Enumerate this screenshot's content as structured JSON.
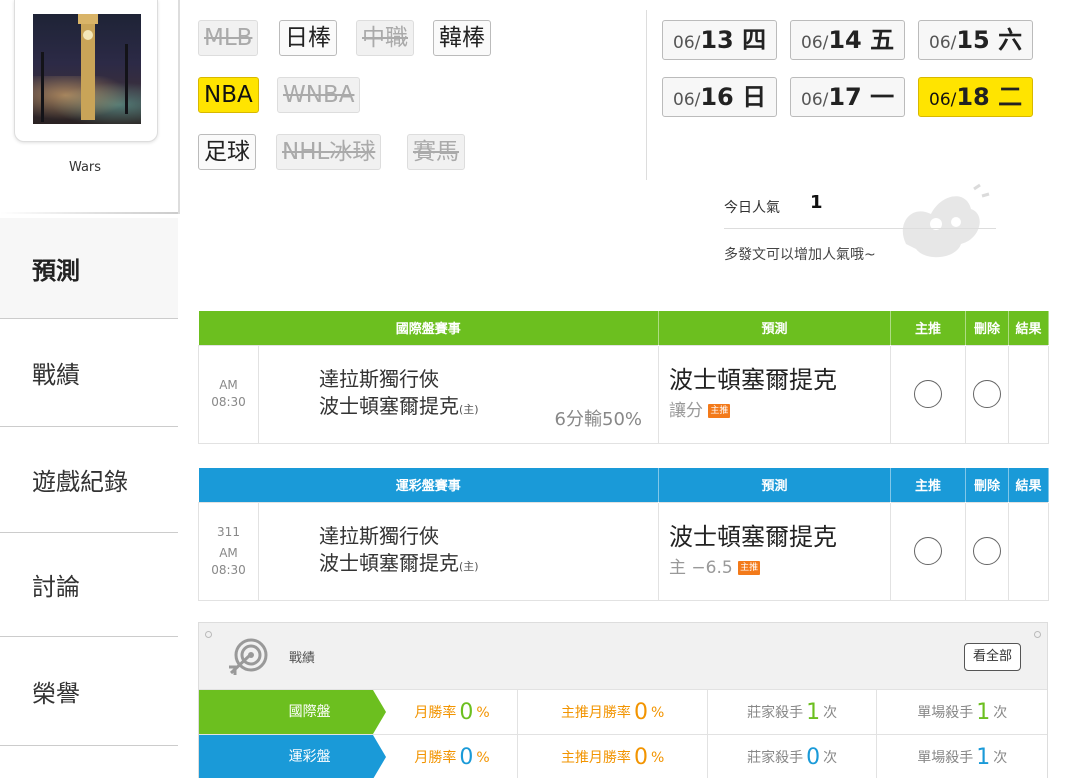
{
  "user": {
    "name": "Wars"
  },
  "nav": {
    "predict": "預測",
    "record": "戰績",
    "history": "遊戲紀錄",
    "discuss": "討論",
    "honor": "榮譽"
  },
  "leagues": {
    "mlb": "MLB",
    "npb": "日棒",
    "cpbl": "中職",
    "kbo": "韓棒",
    "nba": "NBA",
    "wnba": "WNBA",
    "soccer": "足球",
    "nhl": "NHL冰球",
    "horse": "賽馬"
  },
  "dates": [
    {
      "prefix": "06/",
      "day": "13 四"
    },
    {
      "prefix": "06/",
      "day": "14 五"
    },
    {
      "prefix": "06/",
      "day": "15 六"
    },
    {
      "prefix": "06/",
      "day": "16 日"
    },
    {
      "prefix": "06/",
      "day": "17 一"
    },
    {
      "prefix": "06/",
      "day": "18 二"
    }
  ],
  "popularity": {
    "label": "今日人氣",
    "value": "1",
    "hint": "多發文可以增加人氣哦~"
  },
  "intl_table": {
    "headers": [
      "國際盤賽事",
      "預測",
      "主推",
      "刪除",
      "結果"
    ],
    "row": {
      "ampm": "AM",
      "time": "08:30",
      "away": "達拉斯獨行俠",
      "home": "波士頓塞爾提克",
      "home_mark": "(主)",
      "odds": "6分輸50%",
      "pred_team": "波士頓塞爾提克",
      "pred_type": "讓分",
      "badge": "主推"
    }
  },
  "lottery_table": {
    "headers": [
      "運彩盤賽事",
      "預測",
      "主推",
      "刪除",
      "結果"
    ],
    "row": {
      "game_no": "311",
      "ampm": "AM",
      "time": "08:30",
      "away": "達拉斯獨行俠",
      "home": "波士頓塞爾提克",
      "home_mark": "(主)",
      "pred_team": "波士頓塞爾提克",
      "pred_type": "主 −6.5",
      "badge": "主推"
    }
  },
  "record": {
    "title": "戰績",
    "view_all": "看全部",
    "rows": [
      {
        "label": "國際盤",
        "monthly_label": "月勝率",
        "monthly_value": "0",
        "monthly_unit": "%",
        "main_label": "主推月勝率",
        "main_value": "0",
        "main_unit": "%",
        "killer_label": "莊家殺手",
        "killer_value": "1",
        "killer_unit": "次",
        "single_label": "單場殺手",
        "single_value": "1",
        "single_unit": "次"
      },
      {
        "label": "運彩盤",
        "monthly_label": "月勝率",
        "monthly_value": "0",
        "monthly_unit": "%",
        "main_label": "主推月勝率",
        "main_value": "0",
        "main_unit": "%",
        "killer_label": "莊家殺手",
        "killer_value": "0",
        "killer_unit": "次",
        "single_label": "單場殺手",
        "single_value": "1",
        "single_unit": "次"
      }
    ]
  },
  "colors": {
    "green": "#6cbf1f",
    "blue": "#1a9ad8",
    "yellow": "#ffe400",
    "orange": "#f29400"
  }
}
